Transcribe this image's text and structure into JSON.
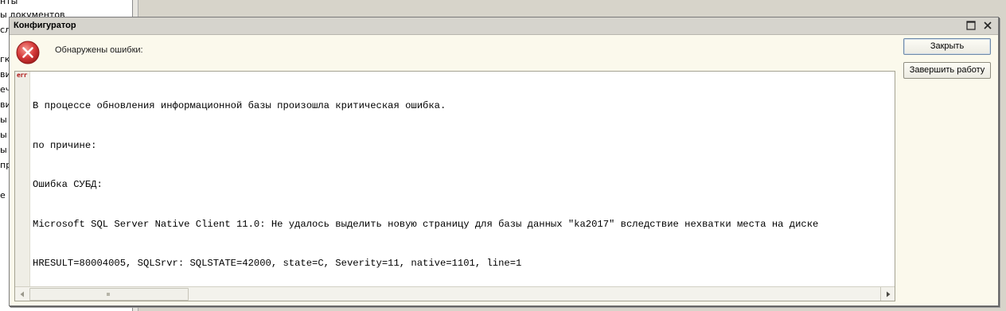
{
  "background": {
    "left_panel_items": [
      "нты",
      "ы документов",
      "сл",
      "гк",
      "ви",
      "еч",
      "ви",
      "ы",
      "ы",
      "ы",
      "пр",
      "е г"
    ]
  },
  "dialog": {
    "title": "Конфигуратор",
    "header_text": "Обнаружены ошибки:",
    "message": {
      "marker": "err",
      "lines": [
        "В процессе обновления информационной базы произошла критическая ошибка.",
        "по причине:",
        "Ошибка СУБД:",
        "Microsoft SQL Server Native Client 11.0: Не удалось выделить новую страницу для базы данных \"ka2017\" вследствие нехватки места на диске",
        "HRESULT=80004005, SQLSrvr: SQLSTATE=42000, state=C, Severity=11, native=1101, line=1"
      ]
    },
    "buttons": {
      "close_label": "Закрыть",
      "exit_label": "Завершить работу"
    }
  },
  "colors": {
    "dialog_bg": "#fbf9ec",
    "error_icon": "#d63b3b",
    "err_marker": "#b01818"
  }
}
